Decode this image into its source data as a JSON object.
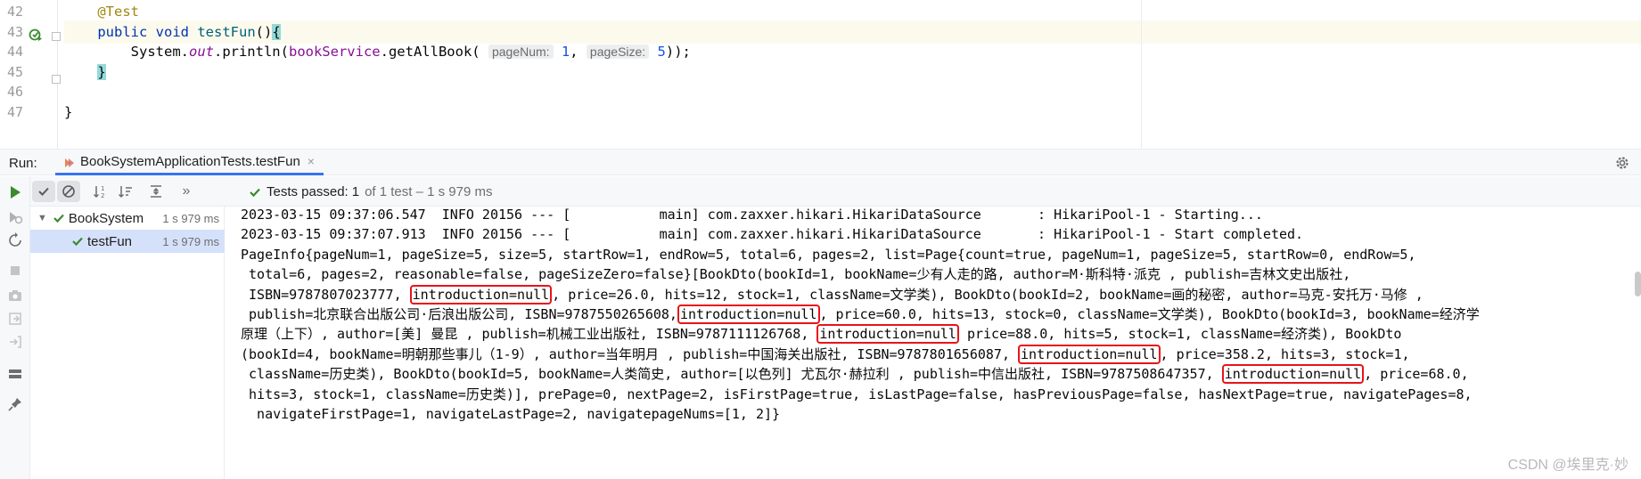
{
  "editor": {
    "lines": [
      {
        "num": "42",
        "tokens": [
          {
            "t": "    ",
            "c": ""
          },
          {
            "t": "@Test",
            "c": "tok-ann"
          }
        ]
      },
      {
        "num": "43",
        "current": true,
        "tokens": [
          {
            "t": "    ",
            "c": ""
          },
          {
            "t": "public ",
            "c": "tok-kw"
          },
          {
            "t": "void ",
            "c": "tok-kw"
          },
          {
            "t": "testFun",
            "c": "tok-fn"
          },
          {
            "t": "()",
            "c": ""
          },
          {
            "t": "{",
            "c": "brace-hl"
          }
        ]
      },
      {
        "num": "44",
        "tokens": [
          {
            "t": "        System.",
            "c": ""
          },
          {
            "t": "out",
            "c": "tok-static"
          },
          {
            "t": ".println(",
            "c": ""
          },
          {
            "t": "bookService",
            "c": "tok-field"
          },
          {
            "t": ".getAllBook( ",
            "c": ""
          },
          {
            "t": "pageNum:",
            "c": "tok-hint"
          },
          {
            "t": " ",
            "c": ""
          },
          {
            "t": "1",
            "c": "tok-num"
          },
          {
            "t": ", ",
            "c": ""
          },
          {
            "t": "pageSize:",
            "c": "tok-hint"
          },
          {
            "t": " ",
            "c": ""
          },
          {
            "t": "5",
            "c": "tok-num"
          },
          {
            "t": "));",
            "c": ""
          }
        ]
      },
      {
        "num": "45",
        "tokens": [
          {
            "t": "    ",
            "c": ""
          },
          {
            "t": "}",
            "c": "brace-hl"
          }
        ]
      },
      {
        "num": "46",
        "tokens": []
      },
      {
        "num": "47",
        "tokens": [
          {
            "t": "}",
            "c": ""
          }
        ]
      }
    ]
  },
  "run_panel": {
    "label": "Run:",
    "tab_title": "BookSystemApplicationTests.testFun",
    "close_glyph": "×",
    "tests_passed_label": "Tests passed:",
    "tests_passed_count": "1",
    "tests_passed_detail": "of 1 test – 1 s 979 ms",
    "toolbar_more": "»"
  },
  "tree": {
    "root_label": "BookSystem",
    "root_time": "1 s 979 ms",
    "child_label": "testFun",
    "child_time": "1 s 979 ms"
  },
  "console": {
    "lines": [
      {
        "segs": [
          {
            "t": "2023-03-15 09:37:06.547  INFO 20156 --- [           main] com.zaxxer.hikari.HikariDataSource       : HikariPool-1 - Starting..."
          }
        ]
      },
      {
        "segs": [
          {
            "t": "2023-03-15 09:37:07.913  INFO 20156 --- [           main] com.zaxxer.hikari.HikariDataSource       : HikariPool-1 - Start completed."
          }
        ]
      },
      {
        "segs": [
          {
            "t": "PageInfo{pageNum=1, pageSize=5, size=5, startRow=1, endRow=5, total=6, pages=2, list=Page{count=true, pageNum=1, pageSize=5, startRow=0, endRow=5,"
          }
        ]
      },
      {
        "segs": [
          {
            "t": " total=6, pages=2, reasonable=false, pageSizeZero=false}[BookDto(bookId=1, bookName=少有人走的路, author=M·斯科特·派克 , publish=吉林文史出版社,"
          }
        ]
      },
      {
        "segs": [
          {
            "t": " ISBN=9787807023777, "
          },
          {
            "t": "introduction=null",
            "hl": true
          },
          {
            "t": ", price=26.0, hits=12, stock=1, className=文学类), BookDto(bookId=2, bookName=画的秘密, author=马克-安托万·马修 ,"
          }
        ]
      },
      {
        "segs": [
          {
            "t": " publish=北京联合出版公司·后浪出版公司, ISBN=9787550265608,"
          },
          {
            "t": "introduction=null",
            "hl": true
          },
          {
            "t": ", price=60.0, hits=13, stock=0, className=文学类), BookDto(bookId=3, bookName=经济学"
          }
        ]
      },
      {
        "segs": [
          {
            "t": "原理（上下）, author=[美] 曼昆 , publish=机械工业出版社, ISBN=9787111126768, "
          },
          {
            "t": "introduction=null",
            "hl": true
          },
          {
            "t": " price=88.0, hits=5, stock=1, className=经济类), BookDto"
          }
        ]
      },
      {
        "segs": [
          {
            "t": "(bookId=4, bookName=明朝那些事儿（1-9）, author=当年明月 , publish=中国海关出版社, ISBN=9787801656087, "
          },
          {
            "t": "introduction=null",
            "hl": true
          },
          {
            "t": ", price=358.2, hits=3, stock=1,"
          }
        ]
      },
      {
        "segs": [
          {
            "t": " className=历史类), BookDto(bookId=5, bookName=人类简史, author=[以色列] 尤瓦尔·赫拉利 , publish=中信出版社, ISBN=9787508647357, "
          },
          {
            "t": "introduction=null",
            "hl": true
          },
          {
            "t": ", price=68.0,"
          }
        ]
      },
      {
        "segs": [
          {
            "t": " hits=3, stock=1, className=历史类)], prePage=0, nextPage=2, isFirstPage=true, isLastPage=false, hasPreviousPage=false, hasNextPage=true, navigatePages=8,"
          }
        ]
      },
      {
        "segs": [
          {
            "t": "  navigateFirstPage=1, navigateLastPage=2, navigatepageNums=[1, 2]}"
          }
        ]
      }
    ]
  },
  "watermark": "CSDN @埃里克·妙",
  "icons": {
    "run": "run-icon",
    "settings": "gear-icon",
    "check": "check-icon",
    "stop": "stop-icon"
  }
}
